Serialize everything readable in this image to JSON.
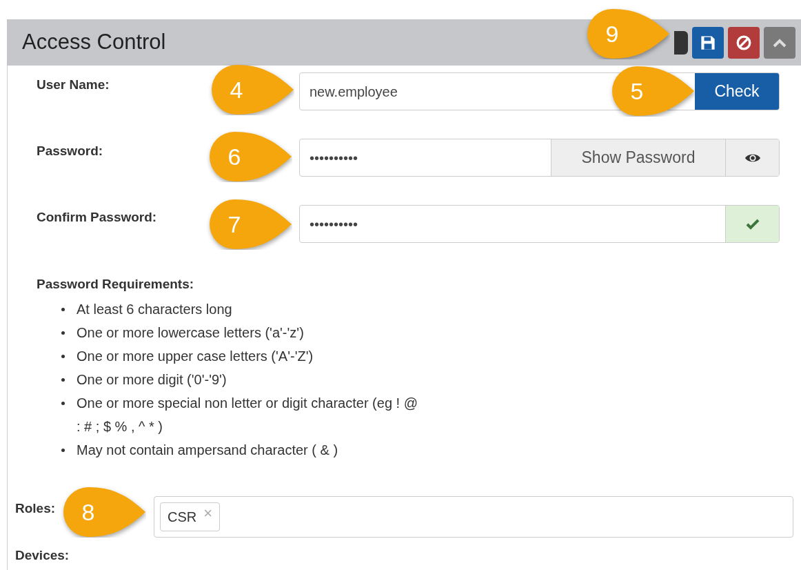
{
  "panel": {
    "title": "Access Control"
  },
  "fields": [
    {
      "kind": "check",
      "label": "User Name:",
      "value": "new.employee",
      "button": "Check"
    },
    {
      "kind": "show",
      "label": "Password:",
      "value": "••••••••••",
      "button": "Show Password"
    },
    {
      "kind": "valid",
      "label": "Confirm Password:",
      "value": "••••••••••"
    }
  ],
  "requirements": {
    "heading": "Password Requirements:",
    "items": [
      "At least 6 characters long",
      "One or more lowercase letters ('a'-'z')",
      "One or more upper case letters ('A'-'Z')",
      "One or more digit ('0'-'9')",
      "One or more special non letter or digit character (eg ! @ : # ; $ % , ^ * )",
      "May not contain ampersand character ( & )"
    ]
  },
  "roles": {
    "label": "Roles:",
    "tags": [
      "CSR"
    ],
    "remove": "×"
  },
  "devices": {
    "label": "Devices:"
  },
  "callouts": [
    {
      "number": "9"
    },
    {
      "number": "4"
    },
    {
      "number": "5"
    },
    {
      "number": "6"
    },
    {
      "number": "7"
    },
    {
      "number": "8"
    }
  ]
}
